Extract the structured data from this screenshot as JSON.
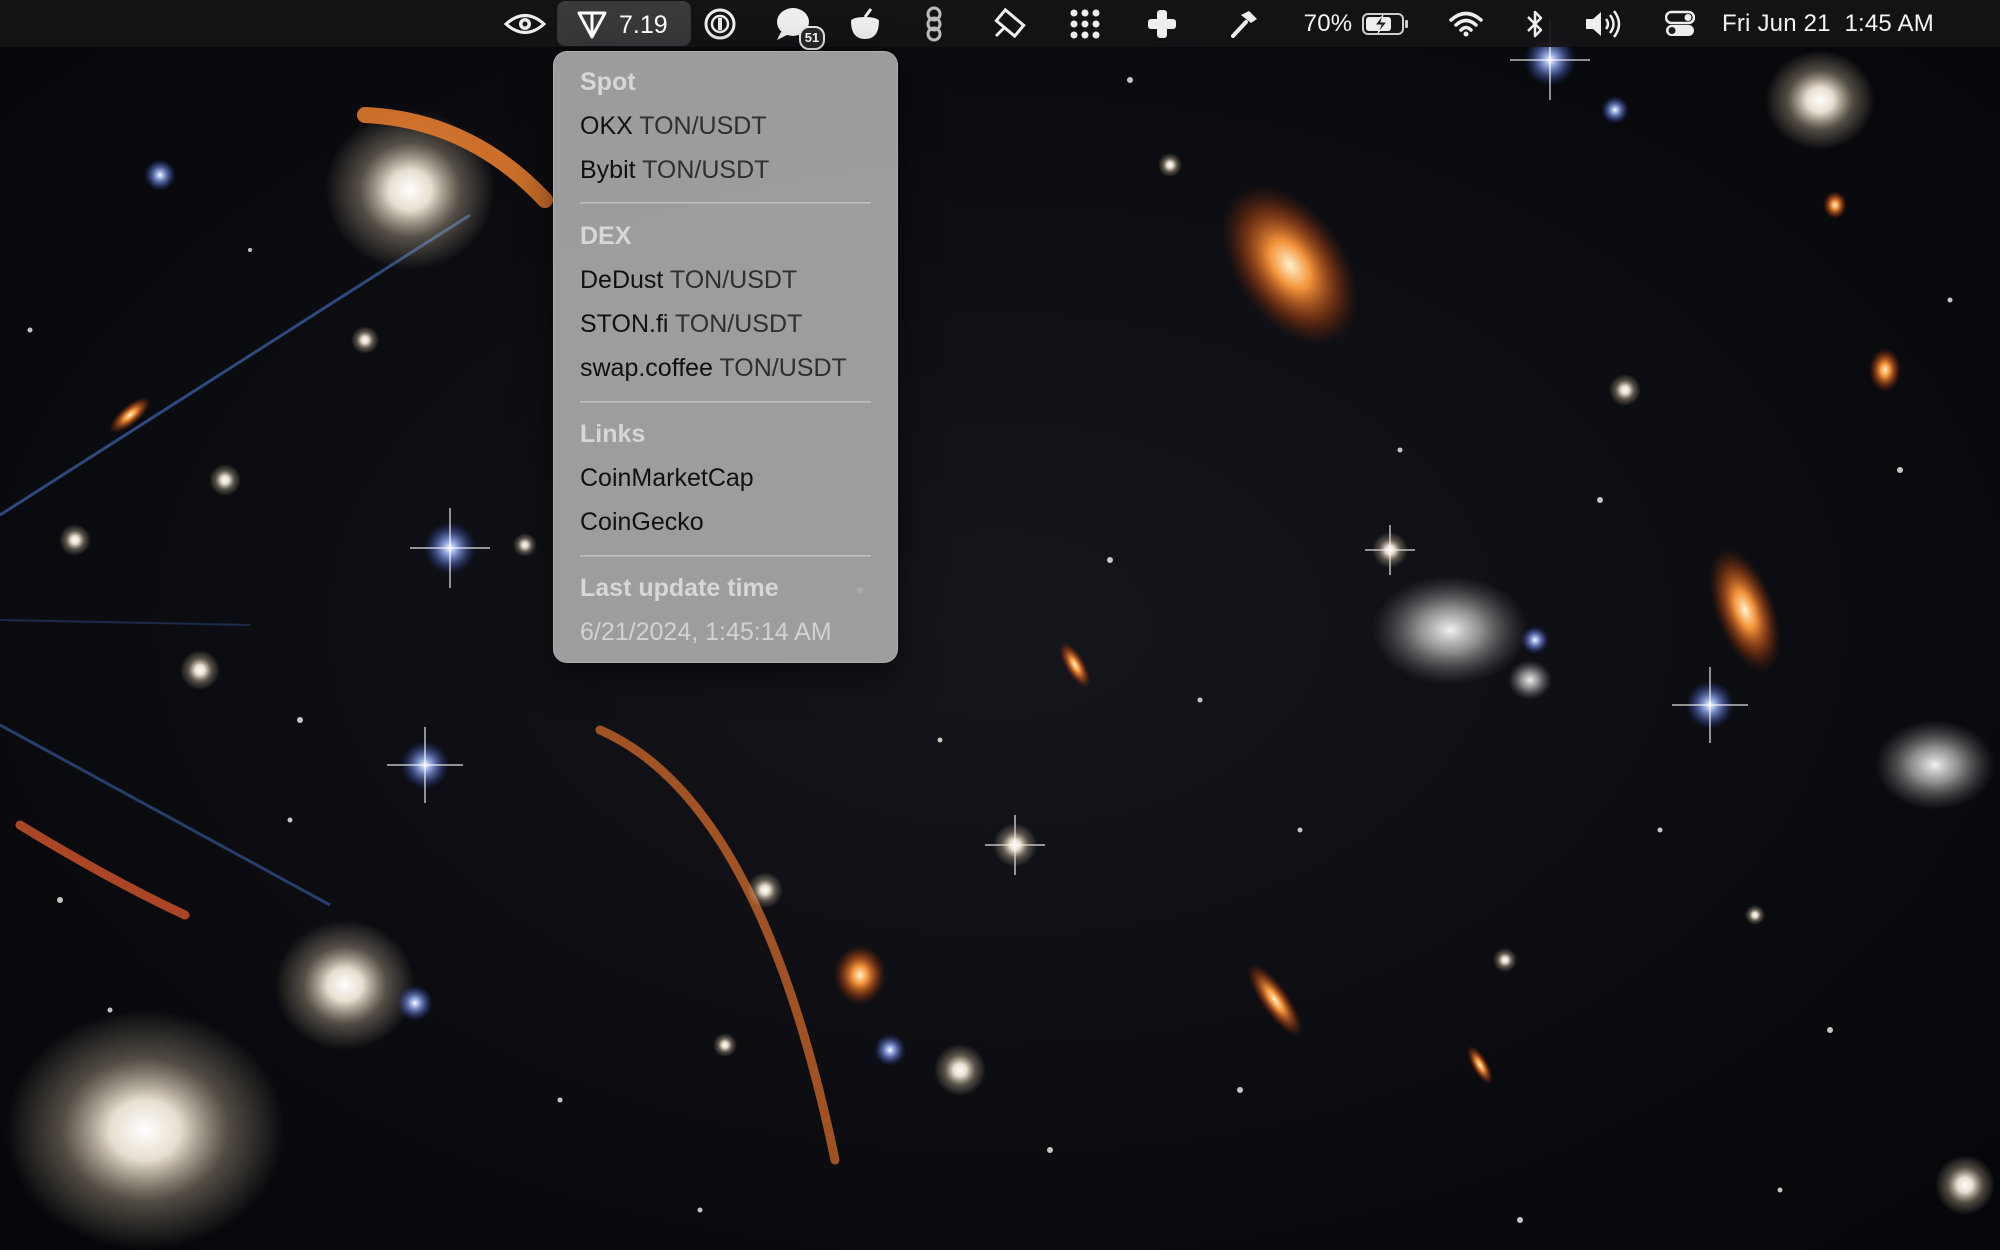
{
  "menubar": {
    "active_app_price": "7.19",
    "notification_count": "51",
    "battery_percent": "70%",
    "clock": "Fri Jun 21  1:45 AM"
  },
  "menu": {
    "spot": {
      "header": "Spot",
      "items": [
        {
          "exchange": "OKX",
          "pair": "TON/USDT"
        },
        {
          "exchange": "Bybit",
          "pair": "TON/USDT"
        }
      ]
    },
    "dex": {
      "header": "DEX",
      "items": [
        {
          "exchange": "DeDust",
          "pair": "TON/USDT"
        },
        {
          "exchange": "STON.fi",
          "pair": "TON/USDT"
        },
        {
          "exchange": "swap.coffee",
          "pair": "TON/USDT"
        }
      ]
    },
    "links": {
      "header": "Links",
      "items": [
        {
          "label": "CoinMarketCap"
        },
        {
          "label": "CoinGecko"
        }
      ]
    },
    "last_update": {
      "header": "Last update time",
      "value": "6/21/2024, 1:45:14 AM"
    }
  }
}
